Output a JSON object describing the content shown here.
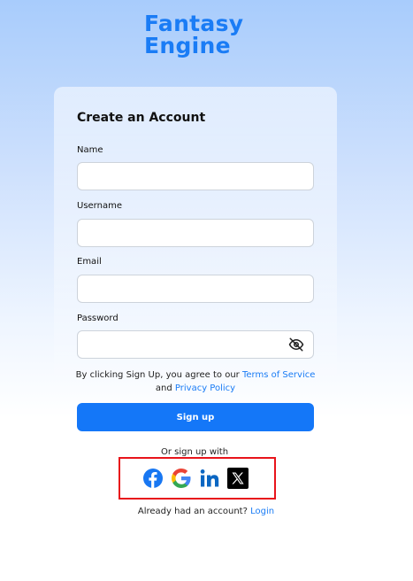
{
  "brand": {
    "line1": "Fantasy",
    "line2": "Engine",
    "color": "#1a7cf5"
  },
  "form": {
    "title": "Create an Account",
    "fields": {
      "name": {
        "label": "Name",
        "value": "",
        "placeholder": ""
      },
      "username": {
        "label": "Username",
        "value": "",
        "placeholder": ""
      },
      "email": {
        "label": "Email",
        "value": "",
        "placeholder": ""
      },
      "password": {
        "label": "Password",
        "value": "",
        "placeholder": "",
        "toggle_icon": "eye-slash-icon"
      }
    },
    "terms": {
      "prefix": "By clicking Sign Up, you agree to our",
      "terms_link": "Terms of Service",
      "and": "and",
      "privacy_link": "Privacy Policy"
    },
    "signup_button": "Sign up",
    "button_color": "#1477f8"
  },
  "social": {
    "prompt": "Or sign up with",
    "providers": [
      {
        "name": "Facebook",
        "icon": "facebook-icon",
        "color": "#1877f2"
      },
      {
        "name": "Google",
        "icon": "google-icon",
        "color": "#4285f4"
      },
      {
        "name": "LinkedIn",
        "icon": "linkedin-icon",
        "color": "#0a66c2"
      },
      {
        "name": "X",
        "icon": "x-icon",
        "color": "#000000"
      }
    ],
    "highlight_color": "#e8141b"
  },
  "footer": {
    "prompt": "Already had an account?",
    "login_link": "Login"
  }
}
